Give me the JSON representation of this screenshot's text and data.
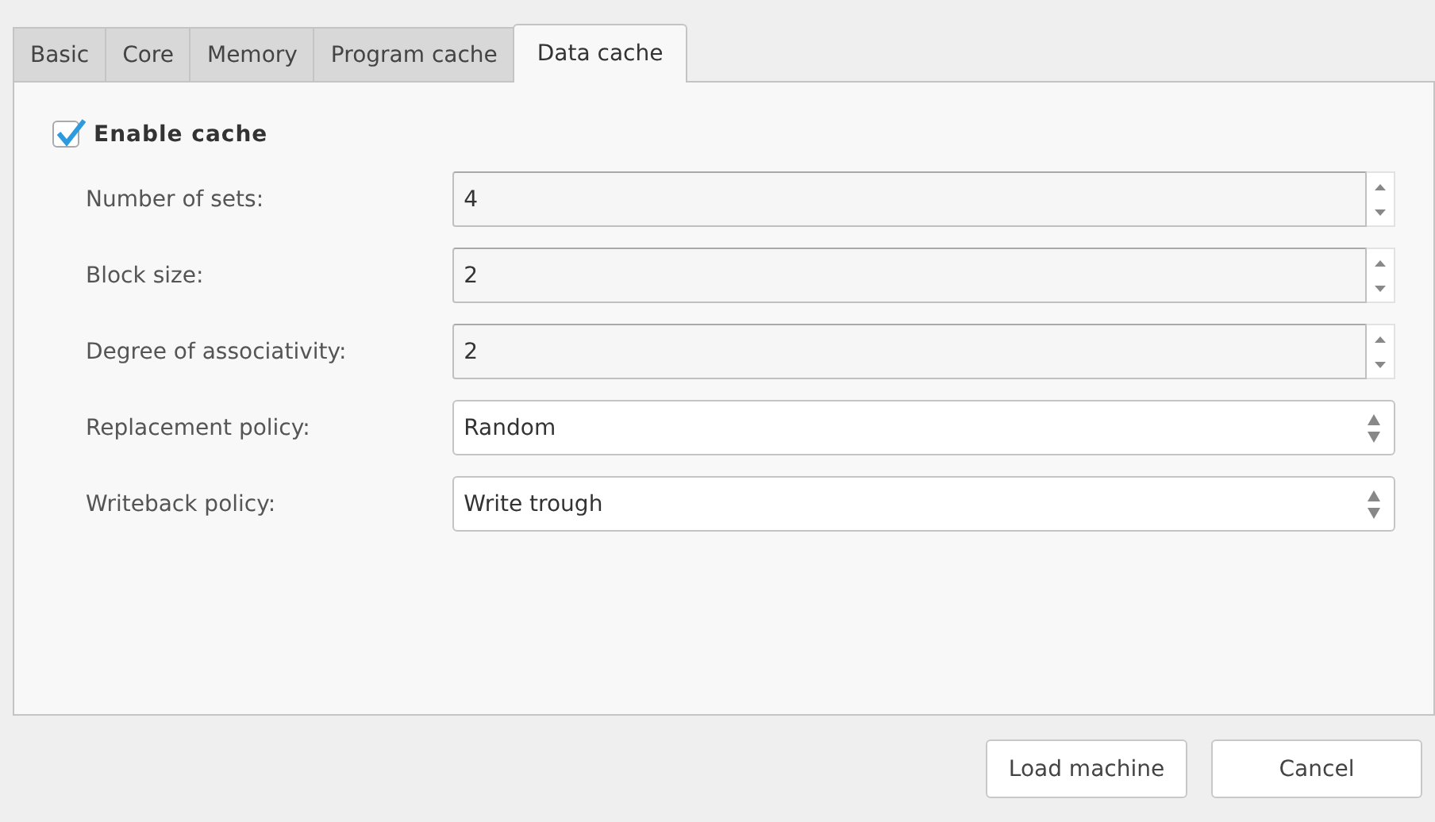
{
  "tabs": [
    {
      "label": "Basic",
      "selected": false
    },
    {
      "label": "Core",
      "selected": false
    },
    {
      "label": "Memory",
      "selected": false
    },
    {
      "label": "Program cache",
      "selected": false
    },
    {
      "label": "Data cache",
      "selected": true
    }
  ],
  "enable_cache": {
    "label": "Enable cache",
    "checked": true
  },
  "fields": [
    {
      "kind": "spinbox",
      "label": "Number of sets:",
      "value": "4"
    },
    {
      "kind": "spinbox",
      "label": "Block size:",
      "value": "2"
    },
    {
      "kind": "spinbox",
      "label": "Degree of associativity:",
      "value": "2"
    },
    {
      "kind": "combo",
      "label": "Replacement policy:",
      "value": "Random"
    },
    {
      "kind": "combo",
      "label": "Writeback policy:",
      "value": "Write trough"
    }
  ],
  "buttons": [
    "Load machine",
    "Cancel"
  ]
}
